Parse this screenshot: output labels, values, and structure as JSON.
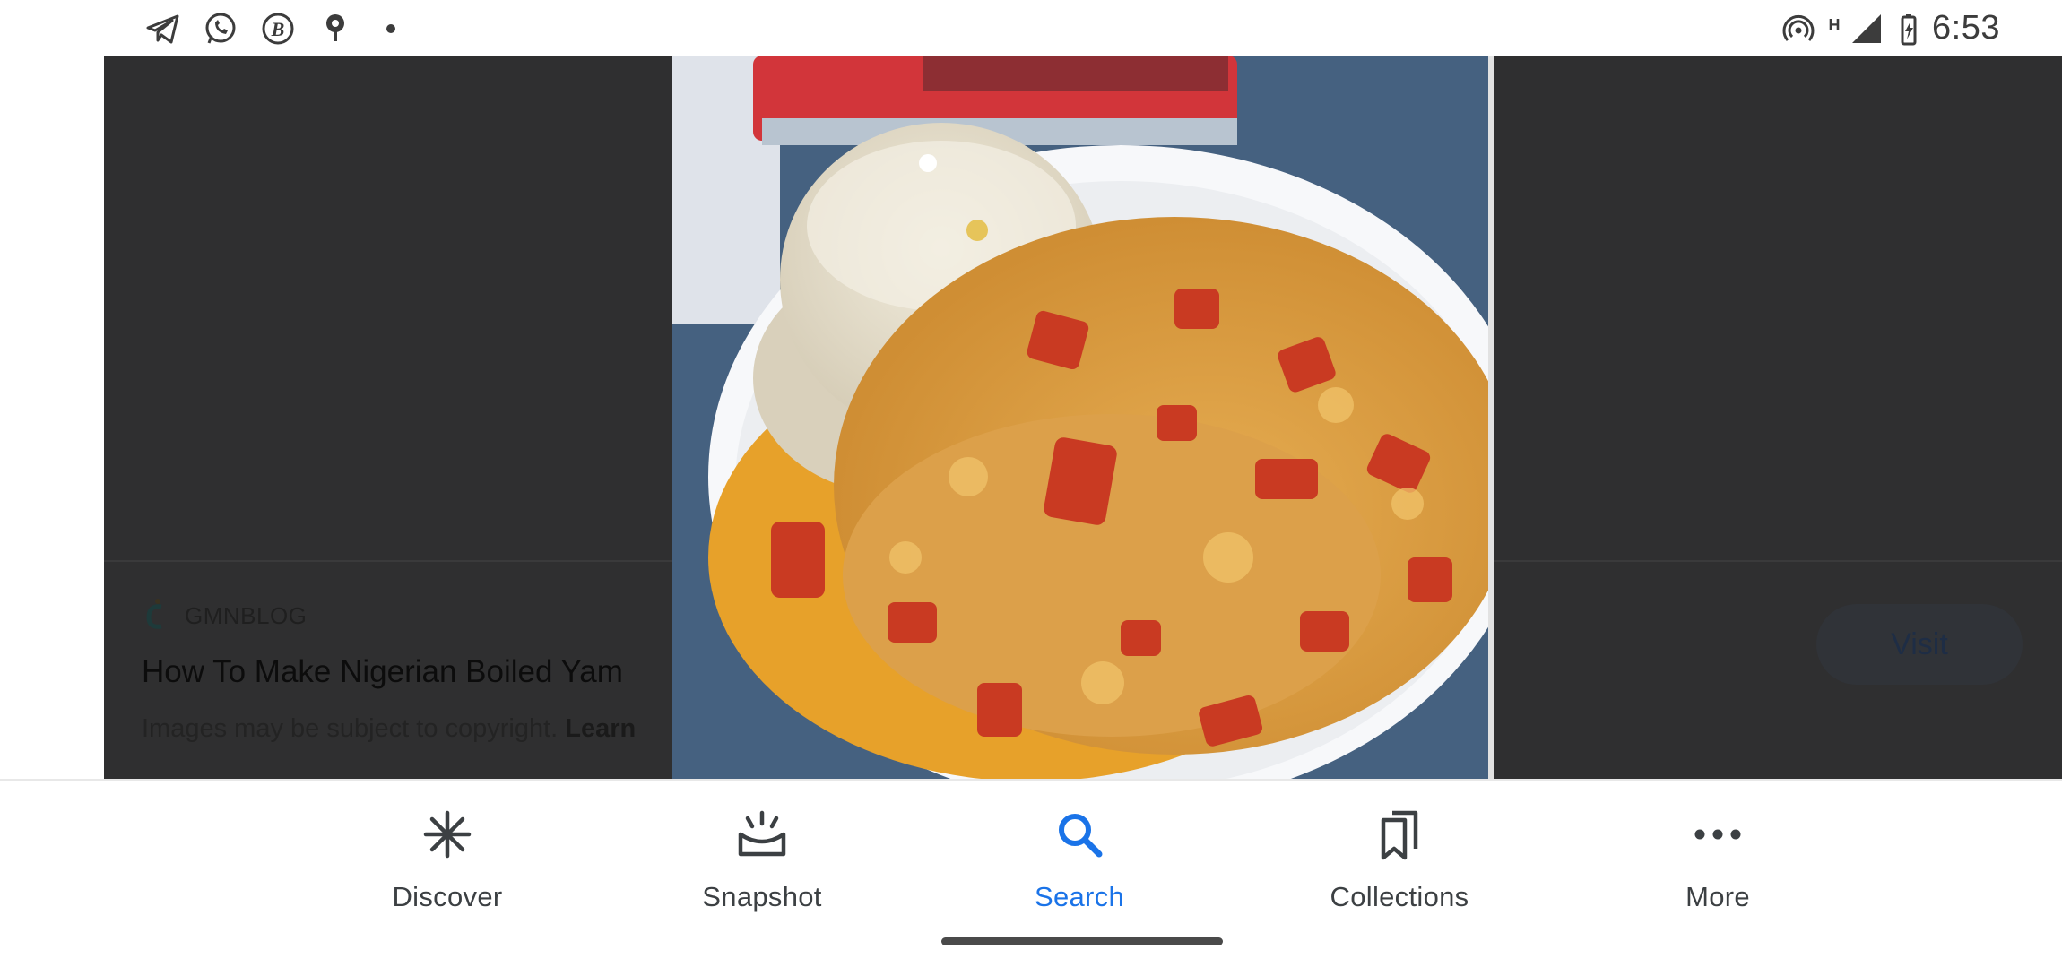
{
  "status_bar": {
    "time": "6:53",
    "left_icons": [
      "telegram-icon",
      "whatsapp-icon",
      "b-app-icon",
      "location-pin-icon",
      "dot-icon"
    ],
    "right_icons": [
      "hotspot-icon",
      "network-h-icon",
      "signal-icon",
      "battery-charging-icon"
    ]
  },
  "result": {
    "source_name": "GMNBLOG",
    "title": "How To Make Nigerian Boiled Yam",
    "copyright_text": "Images may be subject to copyright.",
    "learn_more": "Learn",
    "visit_label": "Visit"
  },
  "image": {
    "subject": "boiled-yam-and-egg-sauce-photo"
  },
  "bottom_nav": {
    "items": [
      {
        "label": "Discover",
        "icon": "asterisk-icon",
        "active": false
      },
      {
        "label": "Snapshot",
        "icon": "snapshot-icon",
        "active": false
      },
      {
        "label": "Search",
        "icon": "search-icon",
        "active": true
      },
      {
        "label": "Collections",
        "icon": "collections-icon",
        "active": false
      },
      {
        "label": "More",
        "icon": "more-dots-icon",
        "active": false
      }
    ]
  },
  "colors": {
    "accent": "#1a73e8",
    "scrim": "#2f2f30",
    "nav_text": "#3c4043"
  }
}
